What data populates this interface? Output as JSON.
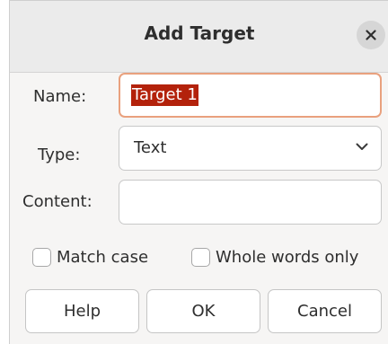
{
  "dialog": {
    "title": "Add Target",
    "close_icon": "close-icon"
  },
  "form": {
    "name_label": "Name:",
    "name_value": "Target 1",
    "type_label": "Type:",
    "type_value": "Text",
    "type_dropdown_icon": "chevron-down-icon",
    "content_label": "Content:",
    "content_value": ""
  },
  "options": {
    "match_case_label": "Match case",
    "match_case_checked": false,
    "whole_words_label": "Whole words only",
    "whole_words_checked": false
  },
  "buttons": {
    "help_label": "Help",
    "ok_label": "OK",
    "cancel_label": "Cancel"
  },
  "colors": {
    "focus_border": "#e9a17e",
    "selection_bg": "#b3220b",
    "dialog_bg": "#f6f5f4",
    "titlebar_bg": "#ebebeb"
  }
}
